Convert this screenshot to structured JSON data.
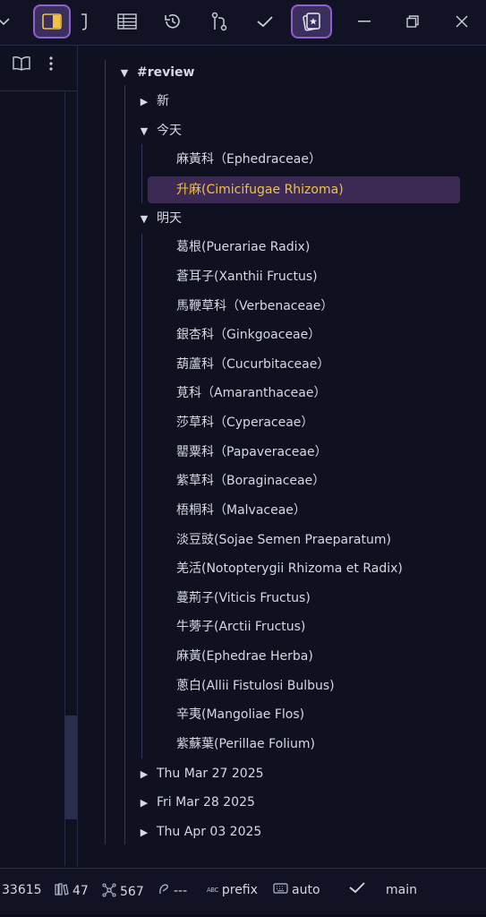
{
  "toolbar": {
    "icons": [
      "chevron-down-icon",
      "sidebar-toggle-icon",
      "bracket-icon",
      "table-icon",
      "history-icon",
      "git-branch-icon",
      "check-icon",
      "flashcard-icon",
      "minimize-icon",
      "restore-icon",
      "close-icon"
    ],
    "accent": "#8e63d1"
  },
  "left_panel": {
    "icons": [
      "book-open-icon",
      "more-vertical-icon"
    ]
  },
  "tree": {
    "root": "#review",
    "groups": [
      {
        "label": "新",
        "expanded": false
      },
      {
        "label": "今天",
        "expanded": true,
        "items": [
          "麻黃科（Ephedraceae）",
          "升麻(Cimicifugae Rhizoma)"
        ]
      },
      {
        "label": "明天",
        "expanded": true,
        "items": [
          "葛根(Puerariae Radix)",
          "蒼耳子(Xanthii Fructus)",
          "馬鞭草科（Verbenaceae）",
          "銀杏科（Ginkgoaceae）",
          "葫蘆科（Cucurbitaceae）",
          "莧科（Amaranthaceae）",
          "莎草科（Cyperaceae）",
          "罌粟科（Papaveraceae）",
          "紫草科（Boraginaceae）",
          "梧桐科（Malvaceae）",
          "淡豆豉(Sojae Semen Praeparatum)",
          "羌活(Notopterygii Rhizoma et Radix)",
          "蔓荊子(Viticis Fructus)",
          "牛蒡子(Arctii Fructus)",
          "麻黃(Ephedrae Herba)",
          "蔥白(Allii Fistulosi Bulbus)",
          "辛夷(Mangoliae Flos)",
          "紫蘇葉(Perillae Folium)"
        ]
      },
      {
        "label": "Thu Mar 27 2025",
        "expanded": false
      },
      {
        "label": "Fri Mar 28 2025",
        "expanded": false
      },
      {
        "label": "Thu Apr 03 2025",
        "expanded": false
      }
    ],
    "selected_color": "#f0c341"
  },
  "status": {
    "count": "33615",
    "files": "47",
    "links": "567",
    "cursor": "---",
    "prefix": "prefix",
    "keyboard": "auto",
    "branch": "main"
  }
}
